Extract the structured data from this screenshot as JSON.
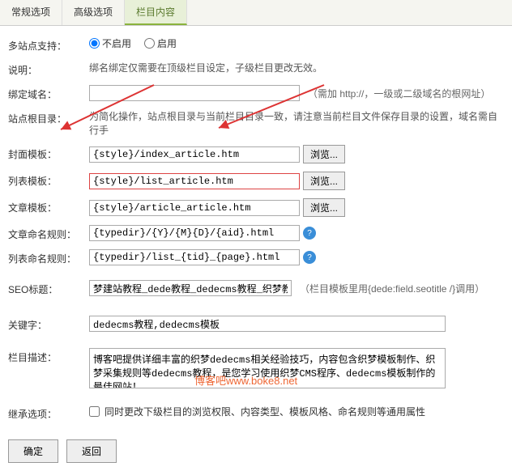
{
  "tabs": {
    "t1": "常规选项",
    "t2": "高级选项",
    "t3": "栏目内容"
  },
  "rows": {
    "multisite": {
      "label": "多站点支持：",
      "opt_off": "不启用",
      "opt_on": "启用"
    },
    "desc": {
      "label": "说明：",
      "text": "绑名绑定仅需要在顶级栏目设定，子级栏目更改无效。"
    },
    "domain": {
      "label": "绑定域名：",
      "hint": "（需加 http://，一级或二级域名的根网址）"
    },
    "root": {
      "label": "站点根目录：",
      "text": "为简化操作，站点根目录与当前栏目目录一致，请注意当前栏目文件保存目录的设置，域名需自行手"
    },
    "cover": {
      "label": "封面模板：",
      "value": "{style}/index_article.htm",
      "btn": "浏览..."
    },
    "list": {
      "label": "列表模板：",
      "value": "{style}/list_article.htm",
      "btn": "浏览..."
    },
    "article": {
      "label": "文章模板：",
      "value": "{style}/article_article.htm",
      "btn": "浏览..."
    },
    "artrule": {
      "label": "文章命名规则：",
      "value": "{typedir}/{Y}/{M}{D}/{aid}.html"
    },
    "listrule": {
      "label": "列表命名规则：",
      "value": "{typedir}/list_{tid}_{page}.html"
    },
    "seo": {
      "label": "SEO标题：",
      "value": "梦建站教程_dede教程_dedecms教程_织梦教程",
      "hint": "（栏目模板里用{dede:field.seotitle /}调用）"
    },
    "keywords": {
      "label": "关键字：",
      "value": "dedecms教程,dedecms模板"
    },
    "descr": {
      "label": "栏目描述：",
      "value": "博客吧提供详细丰富的织梦dedecms相关经验技巧，内容包含织梦模板制作、织梦采集规则等dedecms教程，是您学习使用织梦CMS程序、dedecms模板制作的最佳网站！"
    },
    "inherit": {
      "label": "继承选项：",
      "text": "同时更改下级栏目的浏览权限、内容类型、模板风格、命名规则等通用属性"
    }
  },
  "footer": {
    "ok": "确定",
    "back": "返回"
  },
  "watermark": "博客吧www.boke8.net"
}
